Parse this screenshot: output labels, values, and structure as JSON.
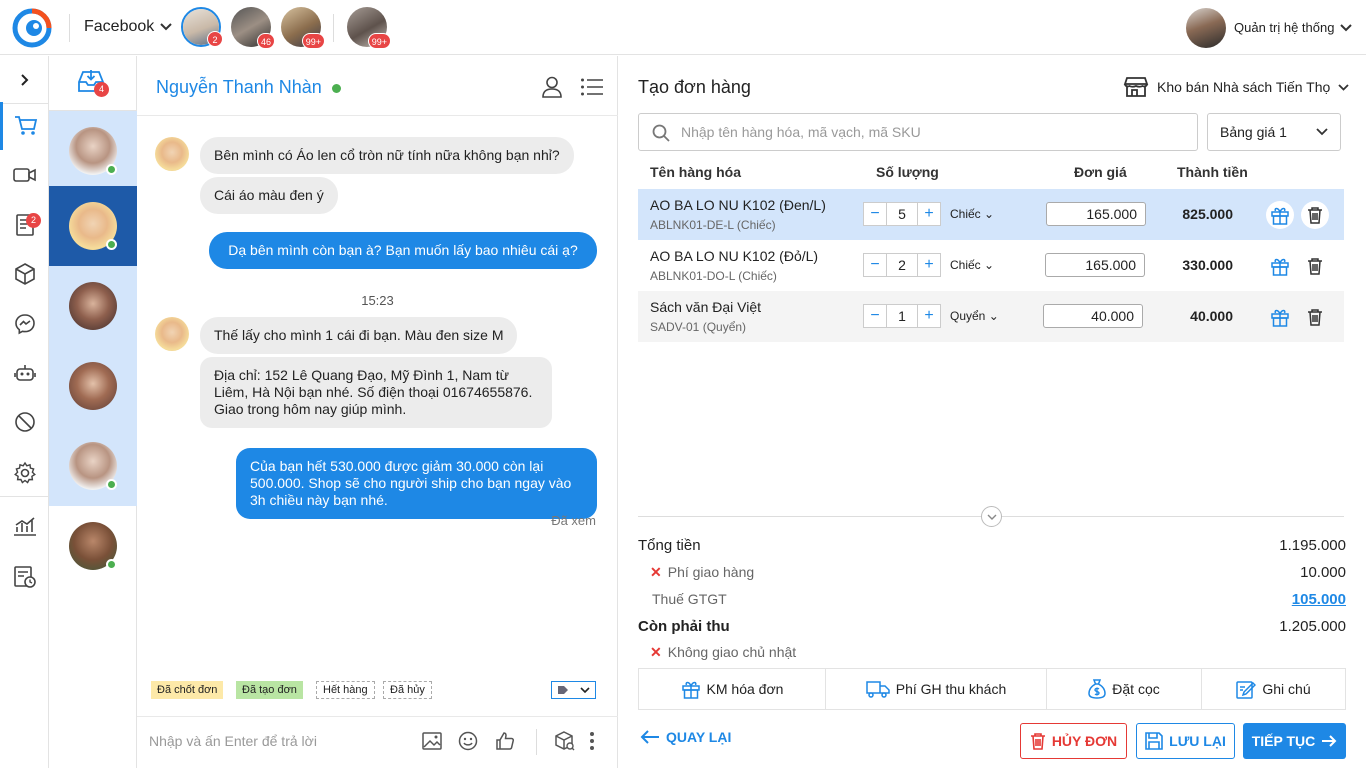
{
  "topbar": {
    "platform": "Facebook",
    "pages": [
      {
        "badge": "2"
      },
      {
        "badge": "46"
      },
      {
        "badge": "99+"
      },
      {
        "badge": "99+"
      }
    ],
    "admin_name": "Quản trị hệ thống"
  },
  "rail": {
    "notes_badge": "2"
  },
  "conversations": {
    "inbox_badge": "4"
  },
  "chat": {
    "contact_name": "Nguyễn Thanh Nhàn",
    "messages": [
      "Bên mình có Áo len cổ tròn nữ tính nữa không bạn nhỉ?",
      "Cái áo màu đen ý",
      "Dạ bên mình còn bạn à? Bạn muốn lấy bao nhiêu cái ạ?",
      "Thế lấy cho mình 1 cái đi bạn. Màu đen size M",
      "Địa chỉ: 152 Lê Quang Đạo, Mỹ Đình 1, Nam từ Liêm, Hà Nội bạn nhé. Số điện thoại 01674655876. Giao trong hôm nay giúp mình.",
      "Của bạn hết 530.000 được giảm 30.000 còn lại 500.000. Shop sẽ cho người ship cho bạn ngay vào 3h chiều này bạn nhé."
    ],
    "time": "15:23",
    "seen": "Đã xem",
    "tags": [
      "Đã chốt đơn",
      "Đã tạo đơn",
      "Hết hàng",
      "Đã hủy"
    ],
    "composer_placeholder": "Nhập và ấn Enter để trả lời"
  },
  "order": {
    "title": "Tạo đơn hàng",
    "store": "Kho bán Nhà sách Tiến Thọ",
    "search_placeholder": "Nhập tên hàng hóa, mã vạch, mã SKU",
    "pricebook": "Bảng giá 1",
    "headers": {
      "name": "Tên hàng hóa",
      "qty": "Số lượng",
      "price": "Đơn giá",
      "total": "Thành tiền"
    },
    "items": [
      {
        "name": "AO BA LO NU K102 (Đen/L)",
        "sku": "ABLNK01-DE-L (Chiếc)",
        "qty": "5",
        "unit": "Chiếc",
        "price": "165.000",
        "total": "825.000"
      },
      {
        "name": "AO BA LO NU K102 (Đỏ/L)",
        "sku": "ABLNK01-DO-L (Chiếc)",
        "qty": "2",
        "unit": "Chiếc",
        "price": "165.000",
        "total": "330.000"
      },
      {
        "name": "Sách văn Đại Việt",
        "sku": "SADV-01 (Quyển)",
        "qty": "1",
        "unit": "Quyển",
        "price": "40.000",
        "total": "40.000"
      }
    ],
    "summary": {
      "total_label": "Tổng tiền",
      "total_value": "1.195.000",
      "shipping_label": "Phí giao hàng",
      "shipping_value": "10.000",
      "vat_label": "Thuế GTGT",
      "vat_value": "105.000",
      "due_label": "Còn phải thu",
      "due_value": "1.205.000",
      "note": "Không giao chủ nhật"
    },
    "actions": [
      "KM hóa đơn",
      "Phí GH thu khách",
      "Đặt cọc",
      "Ghi chú"
    ],
    "footer": {
      "back": "QUAY LẠI",
      "cancel": "HỦY ĐƠN",
      "save": "LƯU LẠI",
      "next": "TIẾP TỤC"
    }
  },
  "colors": {
    "accent": "#1e88e5",
    "danger": "#e53935",
    "online": "#4caf50",
    "selected_row": "#d3e5fb"
  }
}
